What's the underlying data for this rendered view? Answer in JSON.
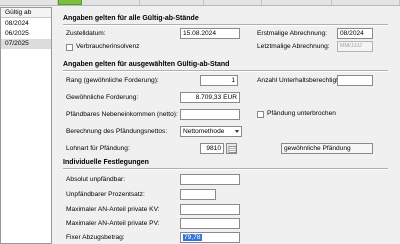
{
  "list": {
    "header": "Gültig ab",
    "items": [
      "08/2024",
      "06/2025",
      "07/2025"
    ]
  },
  "section1": {
    "title": "Angaben gelten für alle Gültig-ab-Stände",
    "zustelldatum_label": "Zustelldatum:",
    "zustelldatum_value": "15.08.2024",
    "erstmalige_label": "Erstmalige Abrechnung:",
    "erstmalige_value": "08/2024",
    "verbraucher_label": "Verbraucherinsolvenz",
    "letztmalige_label": "Letztmalige Abrechnung:",
    "letztmalige_placeholder": "MM/JJJJ"
  },
  "section2": {
    "title": "Angaben gelten für ausgewählten Gültig-ab-Stand",
    "rang_label": "Rang (gewöhnliche Forderung):",
    "rang_value": "1",
    "anzahl_label": "Anzahl Unterhaltsberechtigte:",
    "anzahl_value": "",
    "forderung_label": "Gewöhnliche Forderung:",
    "forderung_value": "8.709,33 EUR",
    "nebeneinkommen_label": "Pfändbares Nebeneinkommen (netto):",
    "nebeneinkommen_value": "",
    "unterbrochen_label": "Pfändung unterbrochen",
    "berechnung_label": "Berechnung des Pfändungsnettos:",
    "berechnung_value": "Nettomethode",
    "lohnart_label": "Lohnart für Pfändung:",
    "lohnart_value": "9810",
    "lohnart_desc": "gewöhnliche Pfändung"
  },
  "section3": {
    "title": "Individuelle Festlegungen",
    "absolut_label": "Absolut unpfändbar:",
    "absolut_value": "",
    "prozentsatz_label": "Unpfändbarer Prozentsatz:",
    "prozentsatz_value": "",
    "kv_label": "Maximaler AN-Anteil private KV:",
    "kv_value": "",
    "pv_label": "Maximaler AN-Anteil private PV:",
    "pv_value": "",
    "fixer_label": "Fixer Abzugsbetrag:",
    "fixer_value": "79,78"
  },
  "colors": {
    "active_tab": "#7fbf3f",
    "selection": "#3874d8"
  }
}
